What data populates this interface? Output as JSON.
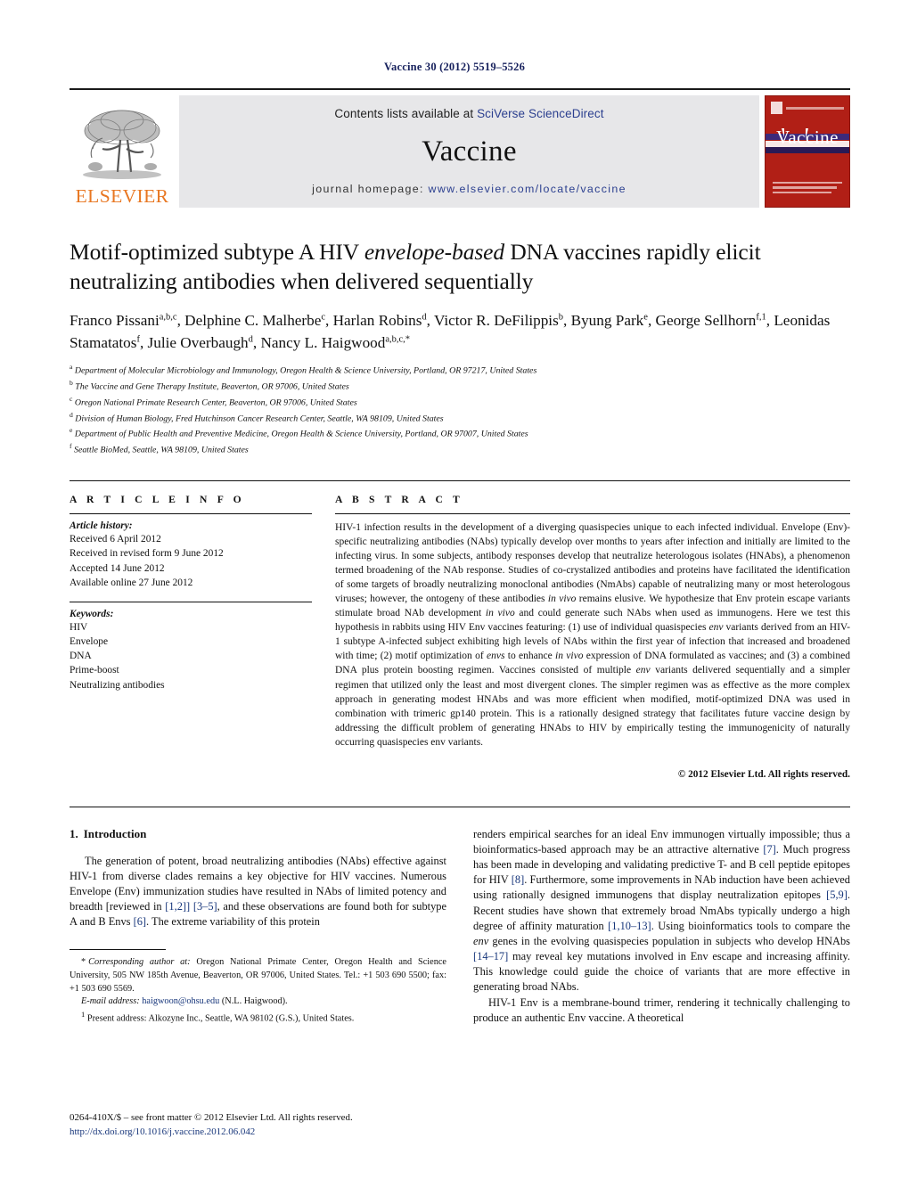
{
  "running_head": "Vaccine 30 (2012) 5519–5526",
  "banner": {
    "publisher": "ELSEVIER",
    "contents_prefix": "Contents lists available at ",
    "contents_link": "SciVerse ScienceDirect",
    "journal_name": "Vaccine",
    "homepage_prefix": "journal homepage: ",
    "homepage_url": "www.elsevier.com/locate/vaccine",
    "cover_title": "Vaccine",
    "link_color": "#2b3f8f",
    "cover_color": "#b11f16",
    "elsevier_orange": "#e87722"
  },
  "article": {
    "title_part1": "Motif-optimized subtype A HIV ",
    "title_italic": "envelope-based",
    "title_part2": " DNA vaccines rapidly elicit neutralizing antibodies when delivered sequentially",
    "authors": [
      {
        "name": "Franco Pissani",
        "sup": "a,b,c",
        "sep": ", "
      },
      {
        "name": "Delphine C. Malherbe",
        "sup": "c",
        "sep": ", "
      },
      {
        "name": "Harlan Robins",
        "sup": "d",
        "sep": ", "
      },
      {
        "name": "Victor R. DeFilippis",
        "sup": "b",
        "sep": ", "
      },
      {
        "name": "Byung Park",
        "sup": "e",
        "sep": ", "
      },
      {
        "name": "George Sellhorn",
        "sup": "f,1",
        "sep": ", "
      },
      {
        "name": "Leonidas Stamatatos",
        "sup": "f",
        "sep": ", "
      },
      {
        "name": "Julie Overbaugh",
        "sup": "d",
        "sep": ", "
      },
      {
        "name": "Nancy L. Haigwood",
        "sup": "a,b,c,*",
        "sep": ""
      }
    ],
    "affiliations": [
      {
        "mark": "a",
        "text": "Department of Molecular Microbiology and Immunology, Oregon Health & Science University, Portland, OR 97217, United States"
      },
      {
        "mark": "b",
        "text": "The Vaccine and Gene Therapy Institute, Beaverton, OR 97006, United States"
      },
      {
        "mark": "c",
        "text": "Oregon National Primate Research Center, Beaverton, OR 97006, United States"
      },
      {
        "mark": "d",
        "text": "Division of Human Biology, Fred Hutchinson Cancer Research Center, Seattle, WA 98109, United States"
      },
      {
        "mark": "e",
        "text": "Department of Public Health and Preventive Medicine, Oregon Health & Science University, Portland, OR 97007, United States"
      },
      {
        "mark": "f",
        "text": "Seattle BioMed, Seattle, WA 98109, United States"
      }
    ]
  },
  "article_info": {
    "heading": "A R T I C L E    I N F O",
    "history_label": "Article history:",
    "history": [
      "Received 6 April 2012",
      "Received in revised form 9 June 2012",
      "Accepted 14 June 2012",
      "Available online 27 June 2012"
    ],
    "keywords_label": "Keywords:",
    "keywords": [
      "HIV",
      "Envelope",
      "DNA",
      "Prime-boost",
      "Neutralizing antibodies"
    ]
  },
  "abstract": {
    "heading": "A B S T R A C T",
    "seg_1": "HIV-1 infection results in the development of a diverging quasispecies unique to each infected individual. Envelope (Env)-specific neutralizing antibodies (NAbs) typically develop over months to years after infection and initially are limited to the infecting virus. In some subjects, antibody responses develop that neutralize heterologous isolates (HNAbs), a phenomenon termed broadening of the NAb response. Studies of co-crystalized antibodies and proteins have facilitated the identification of some targets of broadly neutralizing monoclonal antibodies (NmAbs) capable of neutralizing many or most heterologous viruses; however, the ontogeny of these antibodies ",
    "it_1": "in vivo",
    "seg_2": " remains elusive. We hypothesize that Env protein escape variants stimulate broad NAb development ",
    "it_2": "in vivo",
    "seg_3": " and could generate such NAbs when used as immunogens. Here we test this hypothesis in rabbits using HIV Env vaccines featuring: (1) use of individual quasispecies ",
    "it_3": "env",
    "seg_4": " variants derived from an HIV-1 subtype A-infected subject exhibiting high levels of NAbs within the first year of infection that increased and broadened with time; (2) motif optimization of ",
    "it_4": "envs",
    "seg_5": " to enhance ",
    "it_5": "in vivo",
    "seg_6": " expression of DNA formulated as vaccines; and (3) a combined DNA plus protein boosting regimen. Vaccines consisted of multiple ",
    "it_6": "env",
    "seg_7": " variants delivered sequentially and a simpler regimen that utilized only the least and most divergent clones. The simpler regimen was as effective as the more complex approach in generating modest HNAbs and was more efficient when modified, motif-optimized DNA was used in combination with trimeric gp140 protein. This is a rationally designed strategy that facilitates future vaccine design by addressing the difficult problem of generating HNAbs to HIV by empirically testing the immunogenicity of naturally occurring quasispecies env variants.",
    "copyright": "© 2012 Elsevier Ltd. All rights reserved."
  },
  "introduction": {
    "number": "1.",
    "heading": "Introduction",
    "left_p1_a": "The generation of potent, broad neutralizing antibodies (NAbs) effective against HIV-1 from diverse clades remains a key objective for HIV vaccines. Numerous Envelope (Env) immunization studies have resulted in NAbs of limited potency and breadth [reviewed in ",
    "left_ref1": "[1,2]]",
    "left_p1_b": " ",
    "left_ref2": "[3–5]",
    "left_p1_c": ", and these observations are found both for subtype A and B Envs ",
    "left_ref3": "[6]",
    "left_p1_d": ". The extreme variability of this protein",
    "right_p1_a": "renders empirical searches for an ideal Env immunogen virtually impossible; thus a bioinformatics-based approach may be an attractive alternative ",
    "right_ref1": "[7]",
    "right_p1_b": ". Much progress has been made in developing and validating predictive T- and B cell peptide epitopes for HIV ",
    "right_ref2": "[8]",
    "right_p1_c": ". Furthermore, some improvements in NAb induction have been achieved using rationally designed immunogens that display neutralization epitopes ",
    "right_ref3": "[5,9]",
    "right_p1_d": ". Recent studies have shown that extremely broad NmAbs typically undergo a high degree of affinity maturation ",
    "right_ref4": "[1,10–13]",
    "right_p1_e": ". Using bioinformatics tools to compare the ",
    "right_it1": "env",
    "right_p1_f": " genes in the evolving quasispecies population in subjects who develop HNAbs ",
    "right_ref5": "[14–17]",
    "right_p1_g": " may reveal key mutations involved in Env escape and increasing affinity. This knowledge could guide the choice of variants that are more effective in generating broad NAbs.",
    "right_p2": "HIV-1 Env is a membrane-bound trimer, rendering it technically challenging to produce an authentic Env vaccine. A theoretical"
  },
  "footnotes": {
    "corresponding_star": "*",
    "corresponding_label": "Corresponding author at:",
    "corresponding_text": " Oregon National Primate Center, Oregon Health and Science University, 505 NW 185th Avenue, Beaverton, OR 97006, United States. Tel.: +1 503 690 5500; fax: +1 503 690 5569.",
    "email_label": "E-mail address:",
    "email": "haigwoon@ohsu.edu",
    "email_suffix": " (N.L. Haigwood).",
    "present_mark": "1",
    "present_text": " Present address: Alkozyne Inc., Seattle, WA 98102 (G.S.), United States.",
    "issn_line": "0264-410X/$ – see front matter © 2012 Elsevier Ltd. All rights reserved.",
    "doi": "http://dx.doi.org/10.1016/j.vaccine.2012.06.042"
  }
}
